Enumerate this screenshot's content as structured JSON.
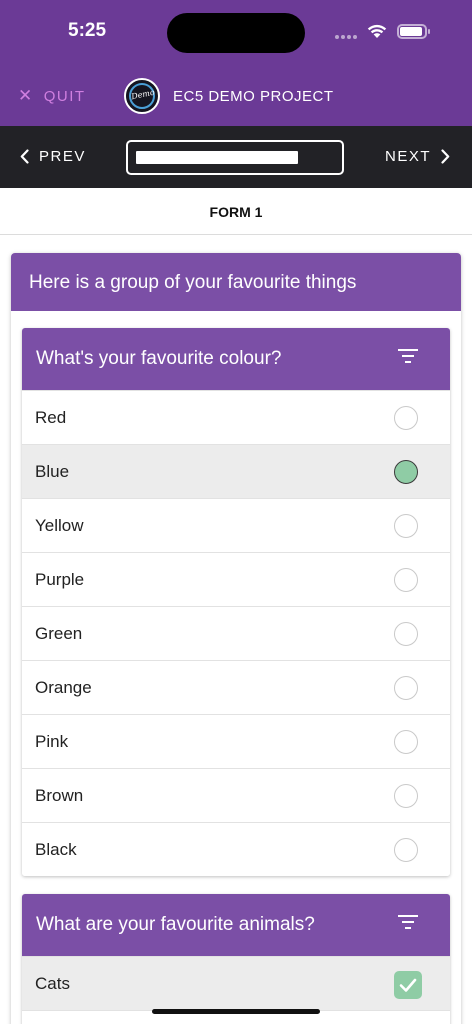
{
  "status": {
    "time": "5:25"
  },
  "header": {
    "quit_label": "QUIT",
    "logo_text": "Demo",
    "project_title": "EC5 DEMO PROJECT"
  },
  "nav": {
    "prev_label": "PREV",
    "next_label": "NEXT",
    "progress_fraction": 0.82
  },
  "form": {
    "name": "FORM 1"
  },
  "group": {
    "title": "Here is a group of your favourite things",
    "q1": {
      "title": "What's your favourite colour?",
      "options": [
        {
          "label": "Red",
          "selected": false
        },
        {
          "label": "Blue",
          "selected": true
        },
        {
          "label": "Yellow",
          "selected": false
        },
        {
          "label": "Purple",
          "selected": false
        },
        {
          "label": "Green",
          "selected": false
        },
        {
          "label": "Orange",
          "selected": false
        },
        {
          "label": "Pink",
          "selected": false
        },
        {
          "label": "Brown",
          "selected": false
        },
        {
          "label": "Black",
          "selected": false
        }
      ]
    },
    "q2": {
      "title": "What are your favourite animals?",
      "options": [
        {
          "label": "Cats",
          "checked": true
        }
      ]
    }
  },
  "colors": {
    "header_bg": "#6b3a96",
    "card_header_bg": "#7b4fa6",
    "nav_bg": "#222226",
    "selected_fill": "#8fcca5",
    "quit_color": "#d07fe0"
  }
}
